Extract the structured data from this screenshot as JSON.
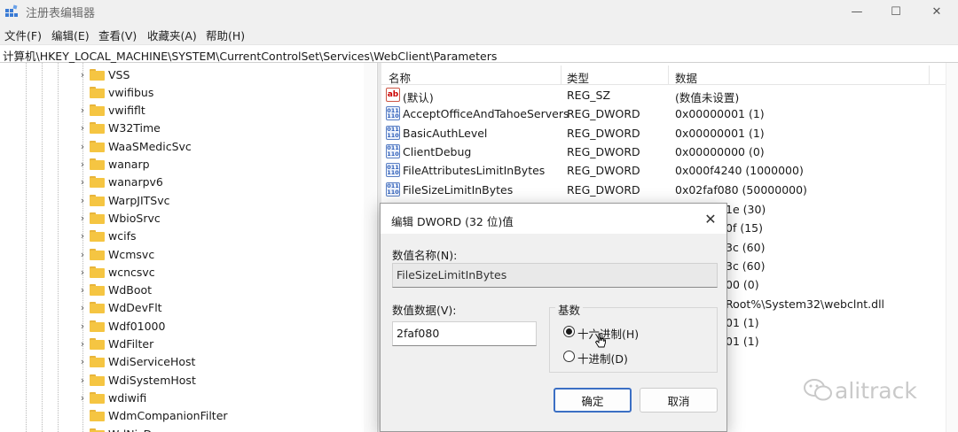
{
  "window": {
    "title": "注册表编辑器",
    "minimize_glyph": "—",
    "maximize_glyph": "☐",
    "close_glyph": "✕"
  },
  "menu": [
    "文件(F)",
    "编辑(E)",
    "查看(V)",
    "收藏夹(A)",
    "帮助(H)"
  ],
  "address": "计算机\\HKEY_LOCAL_MACHINE\\SYSTEM\\CurrentControlSet\\Services\\WebClient\\Parameters",
  "tree": [
    {
      "label": "VSS",
      "expandable": true
    },
    {
      "label": "vwifibus",
      "expandable": false
    },
    {
      "label": "vwififlt",
      "expandable": true
    },
    {
      "label": "W32Time",
      "expandable": true
    },
    {
      "label": "WaaSMedicSvc",
      "expandable": true
    },
    {
      "label": "wanarp",
      "expandable": true
    },
    {
      "label": "wanarpv6",
      "expandable": true
    },
    {
      "label": "WarpJITSvc",
      "expandable": true
    },
    {
      "label": "WbioSrvc",
      "expandable": true
    },
    {
      "label": "wcifs",
      "expandable": true
    },
    {
      "label": "Wcmsvc",
      "expandable": true
    },
    {
      "label": "wcncsvc",
      "expandable": true
    },
    {
      "label": "WdBoot",
      "expandable": true
    },
    {
      "label": "WdDevFlt",
      "expandable": true
    },
    {
      "label": "Wdf01000",
      "expandable": true
    },
    {
      "label": "WdFilter",
      "expandable": true
    },
    {
      "label": "WdiServiceHost",
      "expandable": true
    },
    {
      "label": "WdiSystemHost",
      "expandable": true
    },
    {
      "label": "wdiwifi",
      "expandable": true
    },
    {
      "label": "WdmCompanionFilter",
      "expandable": false
    },
    {
      "label": "WdNisD...",
      "expandable": true
    }
  ],
  "list": {
    "columns": [
      "名称",
      "类型",
      "数据"
    ],
    "rows": [
      {
        "icon": "string-value-icon",
        "name": "(默认)",
        "type": "REG_SZ",
        "data": "(数值未设置)"
      },
      {
        "icon": "binary-value-icon",
        "name": "AcceptOfficeAndTahoeServers",
        "type": "REG_DWORD",
        "data": "0x00000001 (1)"
      },
      {
        "icon": "binary-value-icon",
        "name": "BasicAuthLevel",
        "type": "REG_DWORD",
        "data": "0x00000001 (1)"
      },
      {
        "icon": "binary-value-icon",
        "name": "ClientDebug",
        "type": "REG_DWORD",
        "data": "0x00000000 (0)"
      },
      {
        "icon": "binary-value-icon",
        "name": "FileAttributesLimitInBytes",
        "type": "REG_DWORD",
        "data": "0x000f4240 (1000000)"
      },
      {
        "icon": "binary-value-icon",
        "name": "FileSizeLimitInBytes",
        "type": "REG_DWORD",
        "data": "0x02faf080 (50000000)"
      }
    ],
    "partial_data": [
      "1e (30)",
      "0f (15)",
      "3c (60)",
      "3c (60)",
      "00 (0)",
      "Root%\\System32\\webclnt.dll",
      "01 (1)",
      "01 (1)"
    ]
  },
  "dialog": {
    "title": "编辑 DWORD (32 位)值",
    "name_label": "数值名称(N):",
    "name_value": "FileSizeLimitInBytes",
    "data_label": "数值数据(V):",
    "data_value": "2faf080",
    "base_label": "基数",
    "radio_hex": "十六进制(H)",
    "radio_dec": "十进制(D)",
    "selected_base": "hex",
    "ok": "确定",
    "cancel": "取消",
    "close_glyph": "✕"
  },
  "watermark": "alitrack"
}
